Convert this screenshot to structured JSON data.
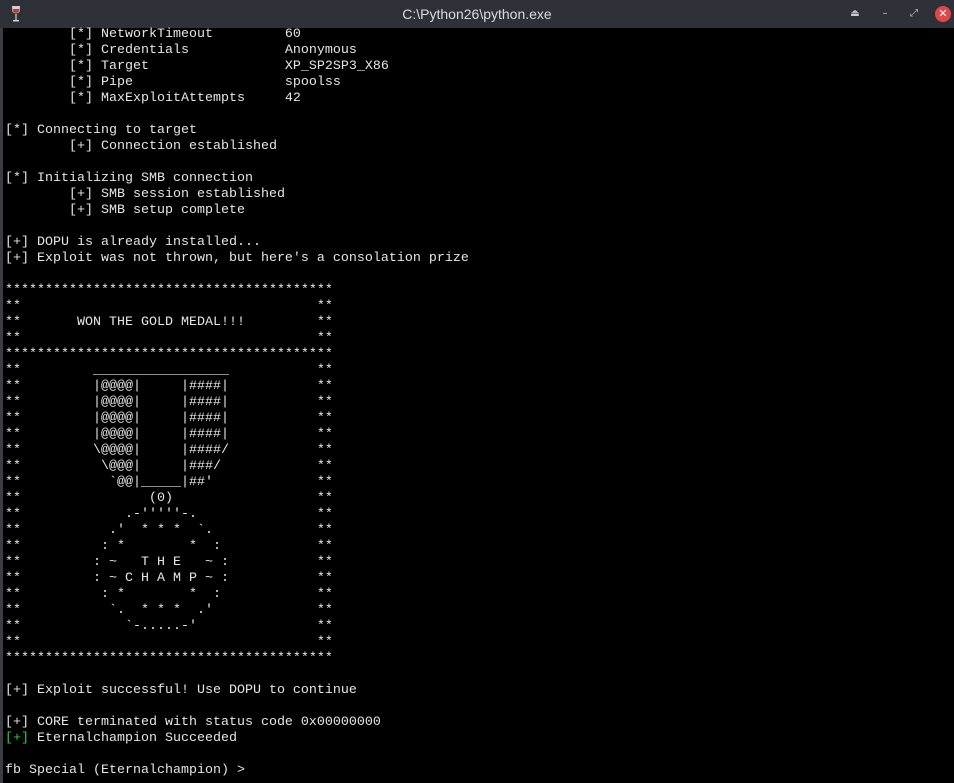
{
  "window": {
    "title": "C:\\Python26\\python.exe",
    "controls": [
      "shade",
      "minimize",
      "maximize",
      "close"
    ]
  },
  "options": [
    {
      "tag": "[*]",
      "label": "NetworkTimeout",
      "value": "60"
    },
    {
      "tag": "[*]",
      "label": "Credentials",
      "value": "Anonymous"
    },
    {
      "tag": "[*]",
      "label": "Target",
      "value": "XP_SP2SP3_X86"
    },
    {
      "tag": "[*]",
      "label": "Pipe",
      "value": "spoolss"
    },
    {
      "tag": "[*]",
      "label": "MaxExploitAttempts",
      "value": "42"
    }
  ],
  "log1": [
    "",
    "[*] Connecting to target",
    "        [+] Connection established",
    "",
    "[*] Initializing SMB connection",
    "        [+] SMB session established",
    "        [+] SMB setup complete",
    "",
    "[+] DOPU is already installed...",
    "[+] Exploit was not thrown, but here's a consolation prize",
    ""
  ],
  "art": [
    "*****************************************",
    "**                                     **",
    "**       WON THE GOLD MEDAL!!!         **",
    "**                                     **",
    "*****************************************",
    "**         _________________           **",
    "**         |@@@@|     |####|           **",
    "**         |@@@@|     |####|           **",
    "**         |@@@@|     |####|           **",
    "**         |@@@@|     |####|           **",
    "**         \\@@@@|     |####/           **",
    "**          \\@@@|     |###/            **",
    "**           `@@|_____|##'             **",
    "**                (0)                  **",
    "**             .-'''''-.               **",
    "**           .'  * * *  `.             **",
    "**          : *        *  :            **",
    "**         : ~   T H E   ~ :           **",
    "**         : ~ C H A M P ~ :           **",
    "**          : *        *  :            **",
    "**           `.  * * *  .'             **",
    "**             `-.....-'               **",
    "**                                     **",
    "*****************************************"
  ],
  "log2": [
    "",
    "[+] Exploit successful! Use DOPU to continue",
    "",
    "[+] CORE terminated with status code 0x00000000"
  ],
  "succeeded": {
    "tag": "[+]",
    "text": " Eternalchampion Succeeded"
  },
  "prompt": {
    "text": "fb Special (Eternalchampion) > "
  },
  "colors": {
    "success_tag": "#2ecc40",
    "close_button": "#e0474c",
    "titlebar": "#2e3238"
  }
}
